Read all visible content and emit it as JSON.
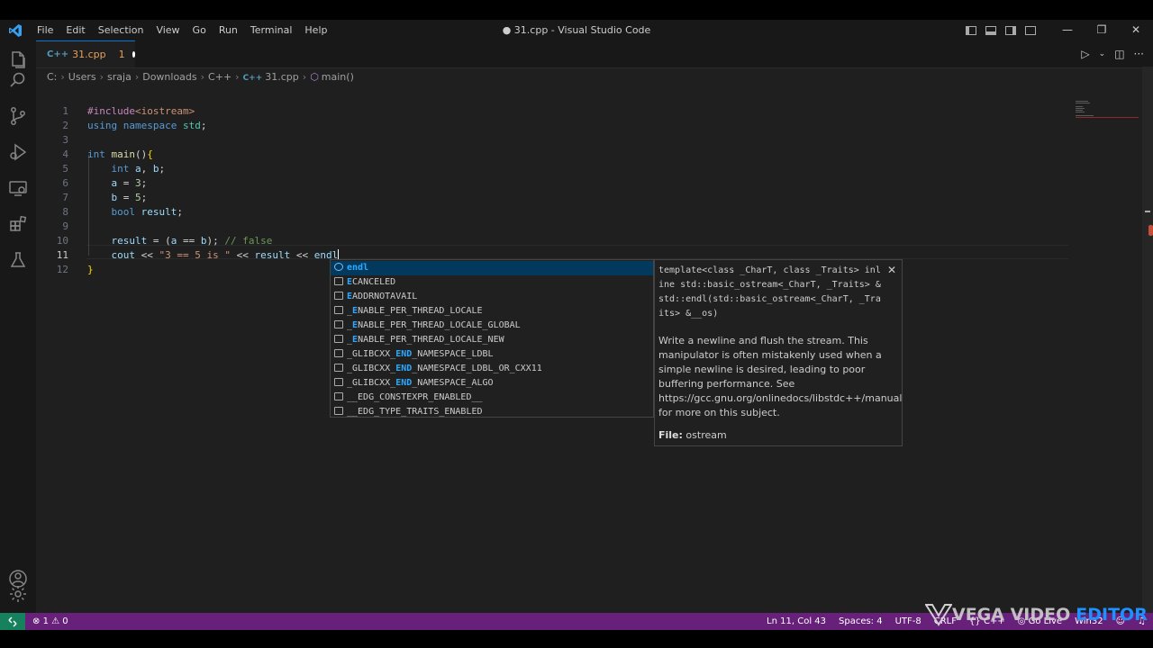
{
  "titlebar": {
    "menus": [
      "File",
      "Edit",
      "Selection",
      "View",
      "Go",
      "Run",
      "Terminal",
      "Help"
    ],
    "window_title": "● 31.cpp - Visual Studio Code"
  },
  "tab": {
    "icon_text": "C++",
    "filename": "31.cpp",
    "problem_count": "1"
  },
  "breadcrumb": {
    "parts": [
      "C:",
      "Users",
      "sraja",
      "Downloads",
      "C++",
      "31.cpp",
      "main()"
    ]
  },
  "editor": {
    "line_numbers": [
      "1",
      "2",
      "3",
      "4",
      "5",
      "6",
      "7",
      "8",
      "9",
      "10",
      "11",
      "12"
    ],
    "current_line": 11,
    "lines": [
      [
        {
          "t": "#include",
          "c": "pp"
        },
        {
          "t": "<iostream>",
          "c": "inc"
        }
      ],
      [
        {
          "t": "using",
          "c": "kw"
        },
        {
          "t": " ",
          "c": "txt"
        },
        {
          "t": "namespace",
          "c": "kw"
        },
        {
          "t": " ",
          "c": "txt"
        },
        {
          "t": "std",
          "c": "ty"
        },
        {
          "t": ";",
          "c": "txt"
        }
      ],
      [],
      [
        {
          "t": "int",
          "c": "kw"
        },
        {
          "t": " ",
          "c": "txt"
        },
        {
          "t": "main",
          "c": "fnc"
        },
        {
          "t": "()",
          "c": "txt"
        },
        {
          "t": "{",
          "c": "brace"
        }
      ],
      [
        {
          "t": "    ",
          "c": "txt"
        },
        {
          "t": "int",
          "c": "kw"
        },
        {
          "t": " ",
          "c": "txt"
        },
        {
          "t": "a",
          "c": "var"
        },
        {
          "t": ", ",
          "c": "txt"
        },
        {
          "t": "b",
          "c": "var"
        },
        {
          "t": ";",
          "c": "txt"
        }
      ],
      [
        {
          "t": "    ",
          "c": "txt"
        },
        {
          "t": "a",
          "c": "var"
        },
        {
          "t": " = ",
          "c": "txt"
        },
        {
          "t": "3",
          "c": "num"
        },
        {
          "t": ";",
          "c": "txt"
        }
      ],
      [
        {
          "t": "    ",
          "c": "txt"
        },
        {
          "t": "b",
          "c": "var"
        },
        {
          "t": " = ",
          "c": "txt"
        },
        {
          "t": "5",
          "c": "num"
        },
        {
          "t": ";",
          "c": "txt"
        }
      ],
      [
        {
          "t": "    ",
          "c": "txt"
        },
        {
          "t": "bool",
          "c": "kw"
        },
        {
          "t": " ",
          "c": "txt"
        },
        {
          "t": "result",
          "c": "var"
        },
        {
          "t": ";",
          "c": "txt"
        }
      ],
      [],
      [
        {
          "t": "    ",
          "c": "txt"
        },
        {
          "t": "result",
          "c": "var"
        },
        {
          "t": " = (",
          "c": "txt"
        },
        {
          "t": "a",
          "c": "var"
        },
        {
          "t": " == ",
          "c": "txt"
        },
        {
          "t": "b",
          "c": "var"
        },
        {
          "t": "); ",
          "c": "txt"
        },
        {
          "t": "// false",
          "c": "cmt"
        }
      ],
      [
        {
          "t": "    ",
          "c": "txt"
        },
        {
          "t": "cout",
          "c": "var"
        },
        {
          "t": " << ",
          "c": "txt"
        },
        {
          "t": "\"3 == 5 is \"",
          "c": "str"
        },
        {
          "t": " << ",
          "c": "txt"
        },
        {
          "t": "result",
          "c": "var"
        },
        {
          "t": " << ",
          "c": "txt"
        },
        {
          "t": "endl",
          "c": "var"
        }
      ],
      [
        {
          "t": "}",
          "c": "brace"
        }
      ]
    ]
  },
  "suggest": {
    "items": [
      {
        "pre": "",
        "hl": "endl",
        "post": "",
        "icon": "keyword"
      },
      {
        "pre": "",
        "hl": "E",
        "post": "CANCELED",
        "icon": "macro"
      },
      {
        "pre": "",
        "hl": "E",
        "post": "ADDRNOTAVAIL",
        "icon": "macro"
      },
      {
        "pre": "_",
        "hl": "E",
        "post": "NABLE_PER_THREAD_LOCALE",
        "icon": "macro"
      },
      {
        "pre": "_",
        "hl": "E",
        "post": "NABLE_PER_THREAD_LOCALE_GLOBAL",
        "icon": "macro"
      },
      {
        "pre": "_",
        "hl": "E",
        "post": "NABLE_PER_THREAD_LOCALE_NEW",
        "icon": "macro"
      },
      {
        "pre": "_GLIBCXX_",
        "hl": "END",
        "post": "_NAMESPACE_LDBL",
        "icon": "macro"
      },
      {
        "pre": "_GLIBCXX_",
        "hl": "END",
        "post": "_NAMESPACE_LDBL_OR_CXX11",
        "icon": "macro"
      },
      {
        "pre": "_GLIBCXX_",
        "hl": "END",
        "post": "_NAMESPACE_ALGO",
        "icon": "macro"
      },
      {
        "pre": "__EDG_CONSTEXPR_ENABLED__",
        "hl": "",
        "post": "",
        "icon": "macro"
      },
      {
        "pre": "__EDG_TYPE_TRAITS_ENABLED",
        "hl": "",
        "post": "",
        "icon": "macro"
      }
    ]
  },
  "docs": {
    "signature": "template<class _CharT, class _Traits> inline std::basic_ostream<_CharT, _Traits> &std::endl(std::basic_ostream<_CharT, _Traits> &__os)",
    "description": "Write a newline and flush the stream. This manipulator is often mistakenly used when a simple newline is desired, leading to poor buffering performance. See https://gcc.gnu.org/onlinedocs/libstdc++/manual/streambufs.html#io.streambuf.buffering for more on this subject.",
    "file_label": "File:",
    "file_value": "ostream"
  },
  "statusbar": {
    "errors": "1",
    "warnings": "0",
    "position": "Ln 11, Col 43",
    "spaces": "Spaces: 4",
    "encoding": "UTF-8",
    "eol": "CRLF",
    "language": "C++",
    "live": "Go Live",
    "platform": "Win32"
  },
  "watermark": {
    "part1": "VEGA VIDEO",
    "part2": "EDITOR"
  },
  "colors": {
    "status_bar": "#68217a",
    "remote": "#16825d",
    "accent": "#0078d4"
  }
}
